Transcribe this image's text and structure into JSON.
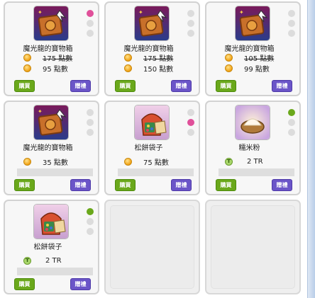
{
  "items": [
    {
      "name": "魔光龍的寶物箱",
      "icon": "treasure-chest-icon",
      "dot_active": "#e0509a",
      "original_price": "175 點數",
      "sale_price": "95 點數",
      "price_type": "points",
      "buy_label": "購買",
      "gift_label": "贈禮"
    },
    {
      "name": "魔光龍的寶物箱",
      "icon": "treasure-chest-icon",
      "dot_active": "",
      "original_price": "175 點數",
      "sale_price": "150 點數",
      "price_type": "points",
      "buy_label": "購買",
      "gift_label": "贈禮"
    },
    {
      "name": "魔光龍的寶物箱",
      "icon": "treasure-chest-icon",
      "dot_active": "",
      "original_price": "105 點數",
      "sale_price": "99 點數",
      "price_type": "points",
      "buy_label": "購買",
      "gift_label": "贈禮"
    },
    {
      "name": "魔光龍的寶物箱",
      "icon": "treasure-chest-icon",
      "dot_active": "",
      "original_price": "",
      "sale_price": "35 點數",
      "price_type": "points",
      "buy_label": "購買",
      "gift_label": "贈禮"
    },
    {
      "name": "松餅袋子",
      "icon": "pancake-bag-icon",
      "dot_active": "#e0509a",
      "original_price": "",
      "sale_price": "75 點數",
      "price_type": "points",
      "buy_label": "購買",
      "gift_label": "贈禮"
    },
    {
      "name": "糯米粉",
      "icon": "rice-flour-icon",
      "dot_active": "#6aa81b",
      "original_price": "",
      "sale_price": "2 TR",
      "price_type": "tr",
      "buy_label": "購買",
      "gift_label": "贈禮"
    },
    {
      "name": "松餅袋子",
      "icon": "pancake-bag-icon",
      "dot_active": "#6aa81b",
      "original_price": "",
      "sale_price": "2 TR",
      "price_type": "tr",
      "buy_label": "購買",
      "gift_label": "贈禮"
    }
  ],
  "tr_coin_letter": "T"
}
